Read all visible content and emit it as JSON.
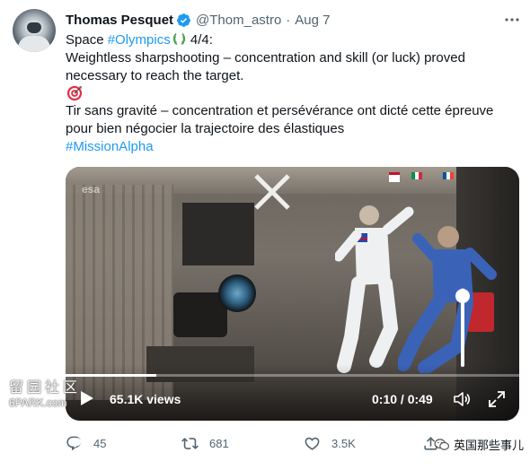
{
  "tweet": {
    "author_name": "Thomas Pesquet",
    "handle": "@Thom_astro",
    "separator": "·",
    "date": "Aug 7",
    "line1_prefix": "Space ",
    "line1_hashtag": "#Olympics",
    "line1_suffix": " 4/4:",
    "line2": "Weightless sharpshooting – concentration and skill (or luck) proved necessary to reach the target.",
    "line3": "Tir sans gravité – concentration et persévérance ont dicté cette épreuve pour bien négocier la trajectoire des élastiques",
    "line4_hashtag": "#MissionAlpha",
    "more_icon": "ellipsis-icon",
    "emojis": [
      "laurel-wreath-icon",
      "direct-hit-target-icon"
    ]
  },
  "media": {
    "views_label": "65.1K views",
    "time_label": "0:10 / 0:49",
    "progress_fraction": 0.2,
    "volume_fraction": 0.9,
    "overlay_logo": "esa"
  },
  "actions": {
    "reply_count": "45",
    "retweet_count": "681",
    "like_count": "3.5K"
  },
  "watermarks": {
    "site_zh": "留园社区",
    "site_en": "6PARK.com",
    "wechat": "英国那些事儿"
  },
  "colors": {
    "link": "#1d9bf0",
    "secondary_text": "#536471",
    "verified": "#1d9bf0"
  }
}
